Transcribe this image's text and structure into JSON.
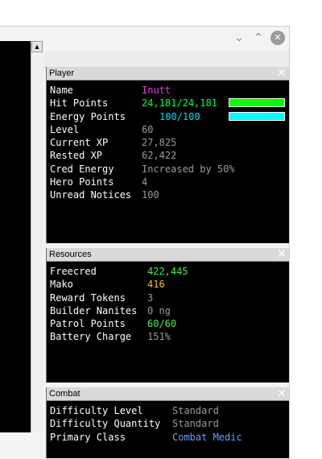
{
  "window": {
    "controls": {
      "minimize": "⌄",
      "maximize": "⌃",
      "close": "✕"
    }
  },
  "scrollbar": {
    "up_arrow": "▲"
  },
  "player": {
    "title": "Player",
    "close": "✕",
    "rows": [
      {
        "label": "Name",
        "value": "Inutt",
        "color": "#e040e0"
      },
      {
        "label": "Hit Points",
        "value": "24,181/24,181",
        "color": "#00ff40"
      },
      {
        "label": "Energy Points",
        "value": "100/100",
        "color": "#00d8f0"
      },
      {
        "label": "Level",
        "value": "60",
        "color": "#9a9a9a"
      },
      {
        "label": "Current XP",
        "value": "27,825",
        "color": "#9a9a9a"
      },
      {
        "label": "Rested XP",
        "value": "62,422",
        "color": "#9a9a9a"
      },
      {
        "label": "Cred Energy",
        "value": "Increased by 50%",
        "color": "#9a9a9a"
      },
      {
        "label": "Hero Points",
        "value": "4",
        "color": "#9a9a9a"
      },
      {
        "label": "Unread Notices",
        "value": "100",
        "color": "#9a9a9a"
      }
    ],
    "hp_bar": {
      "fill_fraction": 1.0,
      "color": "#00ff00"
    },
    "ep_bar": {
      "fill_fraction": 1.0,
      "color": "#00ffff"
    }
  },
  "resources": {
    "title": "Resources",
    "close": "✕",
    "rows": [
      {
        "label": "Freecred",
        "value": "422,445",
        "color": "#40f040"
      },
      {
        "label": "Mako",
        "value": "416",
        "color": "#f0c020"
      },
      {
        "label": "Reward Tokens",
        "value": "3",
        "color": "#9a9a9a"
      },
      {
        "label": "Builder Nanites",
        "value": "0 ng",
        "color": "#9a9a9a"
      },
      {
        "label": "Patrol Points",
        "value": "60/60",
        "color": "#40f040"
      },
      {
        "label": "Battery Charge",
        "value": "151%",
        "color": "#9a9a9a"
      }
    ]
  },
  "combat": {
    "title": "Combat",
    "close": "✕",
    "rows": [
      {
        "label": "Difficulty Level",
        "value": "Standard",
        "color": "#9a9a9a"
      },
      {
        "label": "Difficulty Quantity",
        "value": "Standard",
        "color": "#9a9a9a"
      },
      {
        "label": "Primary Class",
        "value": "Combat Medic",
        "color": "#6aa0f0"
      }
    ]
  }
}
